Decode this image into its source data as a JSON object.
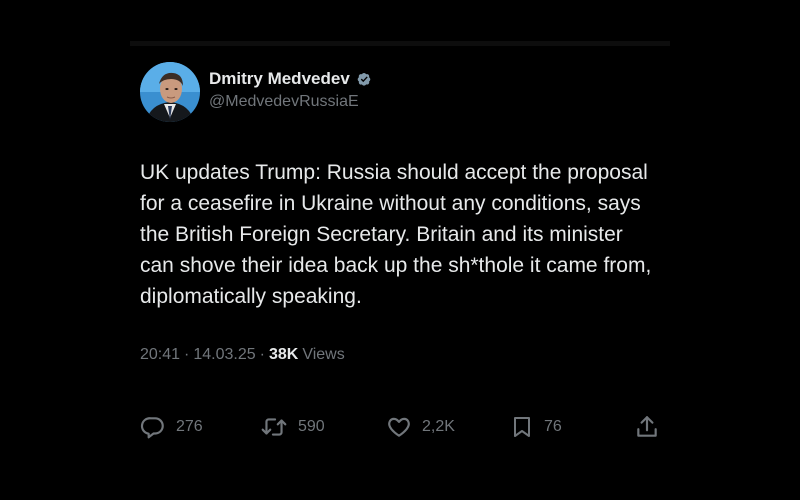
{
  "author": {
    "display_name": "Dmitry Medvedev",
    "handle": "@MedvedevRussiaE",
    "verified": true
  },
  "tweet": {
    "text": "UK updates Trump: Russia should accept the proposal for a ceasefire in Ukraine without any conditions, says the British Foreign Secretary. Britain and its minister can shove their idea back up the sh*thole it came from, diplomatically speaking.",
    "time": "20:41",
    "date": "14.03.25",
    "separator": "·",
    "views_count": "38K",
    "views_label": "Views"
  },
  "actions": {
    "replies": "276",
    "reposts": "590",
    "likes": "2,2K",
    "bookmarks": "76"
  },
  "colors": {
    "background": "#000000",
    "text_primary": "#e7e9ea",
    "text_secondary": "#71767b",
    "verified_badge": "#829aab"
  },
  "icons": {
    "reply": "reply-icon",
    "repost": "repost-icon",
    "like": "heart-icon",
    "bookmark": "bookmark-icon",
    "share": "share-icon",
    "verified": "verified-badge-icon"
  }
}
